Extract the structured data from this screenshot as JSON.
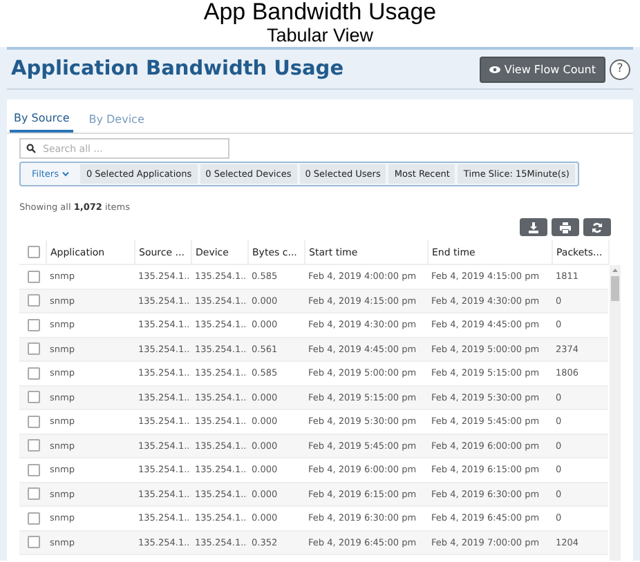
{
  "caption": {
    "title": "App Bandwidth Usage",
    "subtitle": "Tabular View"
  },
  "header": {
    "title": "Application Bandwidth Usage",
    "button": "View Flow Count",
    "help": "?"
  },
  "tabs": [
    {
      "label": "By Source",
      "selected": true
    },
    {
      "label": "By Device",
      "selected": false
    }
  ],
  "search": {
    "placeholder": "Search all ..."
  },
  "filters": {
    "label": "Filters",
    "chips": [
      "0 Selected Applications",
      "0 Selected Devices",
      "0 Selected Users",
      "Most Recent",
      "Time Slice: 15Minute(s)"
    ]
  },
  "summary": "Showing all **1,072** items",
  "table": {
    "select_all": {
      "checked": false
    },
    "columns": [
      "Application",
      "Source ...",
      "Device",
      "Bytes c...",
      "Start time",
      "End time",
      "Packets..."
    ],
    "rows": [
      {
        "checked": false,
        "cells": [
          "snmp",
          "135.254.1...",
          "135.254.1...",
          "0.585",
          "Feb 4, 2019 4:00:00 pm",
          "Feb 4, 2019 4:15:00 pm",
          "1811"
        ]
      },
      {
        "checked": false,
        "cells": [
          "snmp",
          "135.254.1...",
          "135.254.1...",
          "0.000",
          "Feb 4, 2019 4:15:00 pm",
          "Feb 4, 2019 4:30:00 pm",
          "0"
        ]
      },
      {
        "checked": false,
        "cells": [
          "snmp",
          "135.254.1...",
          "135.254.1...",
          "0.000",
          "Feb 4, 2019 4:30:00 pm",
          "Feb 4, 2019 4:45:00 pm",
          "0"
        ]
      },
      {
        "checked": false,
        "cells": [
          "snmp",
          "135.254.1...",
          "135.254.1...",
          "0.561",
          "Feb 4, 2019 4:45:00 pm",
          "Feb 4, 2019 5:00:00 pm",
          "2374"
        ]
      },
      {
        "checked": false,
        "cells": [
          "snmp",
          "135.254.1...",
          "135.254.1...",
          "0.585",
          "Feb 4, 2019 5:00:00 pm",
          "Feb 4, 2019 5:15:00 pm",
          "1806"
        ]
      },
      {
        "checked": false,
        "cells": [
          "snmp",
          "135.254.1...",
          "135.254.1...",
          "0.000",
          "Feb 4, 2019 5:15:00 pm",
          "Feb 4, 2019 5:30:00 pm",
          "0"
        ]
      },
      {
        "checked": false,
        "cells": [
          "snmp",
          "135.254.1...",
          "135.254.1...",
          "0.000",
          "Feb 4, 2019 5:30:00 pm",
          "Feb 4, 2019 5:45:00 pm",
          "0"
        ]
      },
      {
        "checked": false,
        "cells": [
          "snmp",
          "135.254.1...",
          "135.254.1...",
          "0.000",
          "Feb 4, 2019 5:45:00 pm",
          "Feb 4, 2019 6:00:00 pm",
          "0"
        ]
      },
      {
        "checked": false,
        "cells": [
          "snmp",
          "135.254.1...",
          "135.254.1...",
          "0.000",
          "Feb 4, 2019 6:00:00 pm",
          "Feb 4, 2019 6:15:00 pm",
          "0"
        ]
      },
      {
        "checked": false,
        "cells": [
          "snmp",
          "135.254.1...",
          "135.254.1...",
          "0.000",
          "Feb 4, 2019 6:15:00 pm",
          "Feb 4, 2019 6:30:00 pm",
          "0"
        ]
      },
      {
        "checked": false,
        "cells": [
          "snmp",
          "135.254.1...",
          "135.254.1...",
          "0.000",
          "Feb 4, 2019 6:30:00 pm",
          "Feb 4, 2019 6:45:00 pm",
          "0"
        ]
      },
      {
        "checked": false,
        "cells": [
          "snmp",
          "135.254.1...",
          "135.254.1...",
          "0.352",
          "Feb 4, 2019 6:45:00 pm",
          "Feb 4, 2019 7:00:00 pm",
          "1204"
        ]
      }
    ]
  }
}
